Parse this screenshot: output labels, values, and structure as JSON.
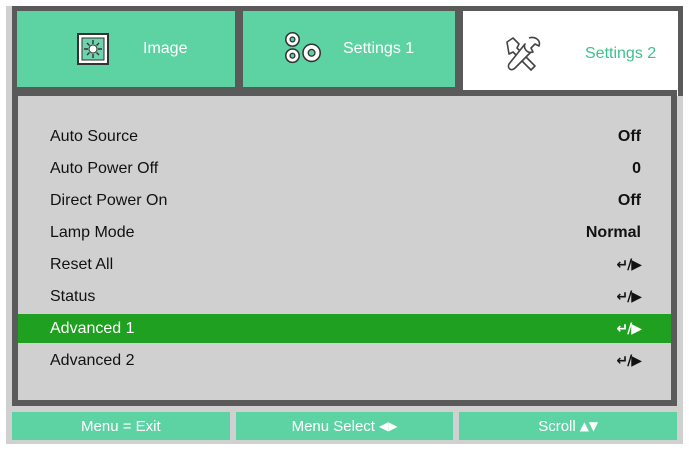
{
  "tabs": [
    {
      "label": "Image",
      "icon": "image-icon",
      "active": false
    },
    {
      "label": "Settings 1",
      "icon": "gears-icon",
      "active": false
    },
    {
      "label": "Settings 2",
      "icon": "tools-icon",
      "active": true
    }
  ],
  "menu": {
    "items": [
      {
        "label": "Auto Source",
        "value": "Off"
      },
      {
        "label": "Auto Power Off",
        "value": "0"
      },
      {
        "label": "Direct Power On",
        "value": "Off"
      },
      {
        "label": "Lamp Mode",
        "value": "Normal"
      },
      {
        "label": "Reset All",
        "value": "↵/▶"
      },
      {
        "label": "Status",
        "value": "↵/▶"
      },
      {
        "label": "Advanced 1",
        "value": "↵/▶",
        "selected": true
      },
      {
        "label": "Advanced 2",
        "value": "↵/▶"
      }
    ]
  },
  "footer": {
    "exit": "Menu = Exit",
    "select": "Menu Select",
    "select_arrows": "◀▶",
    "scroll": "Scroll",
    "scroll_arrows": "▲▼"
  },
  "colors": {
    "tab_green": "#5dd3a4",
    "selected_row": "#20a021",
    "panel_border": "#5a5a5a",
    "panel_bg": "#d0d0d0"
  }
}
